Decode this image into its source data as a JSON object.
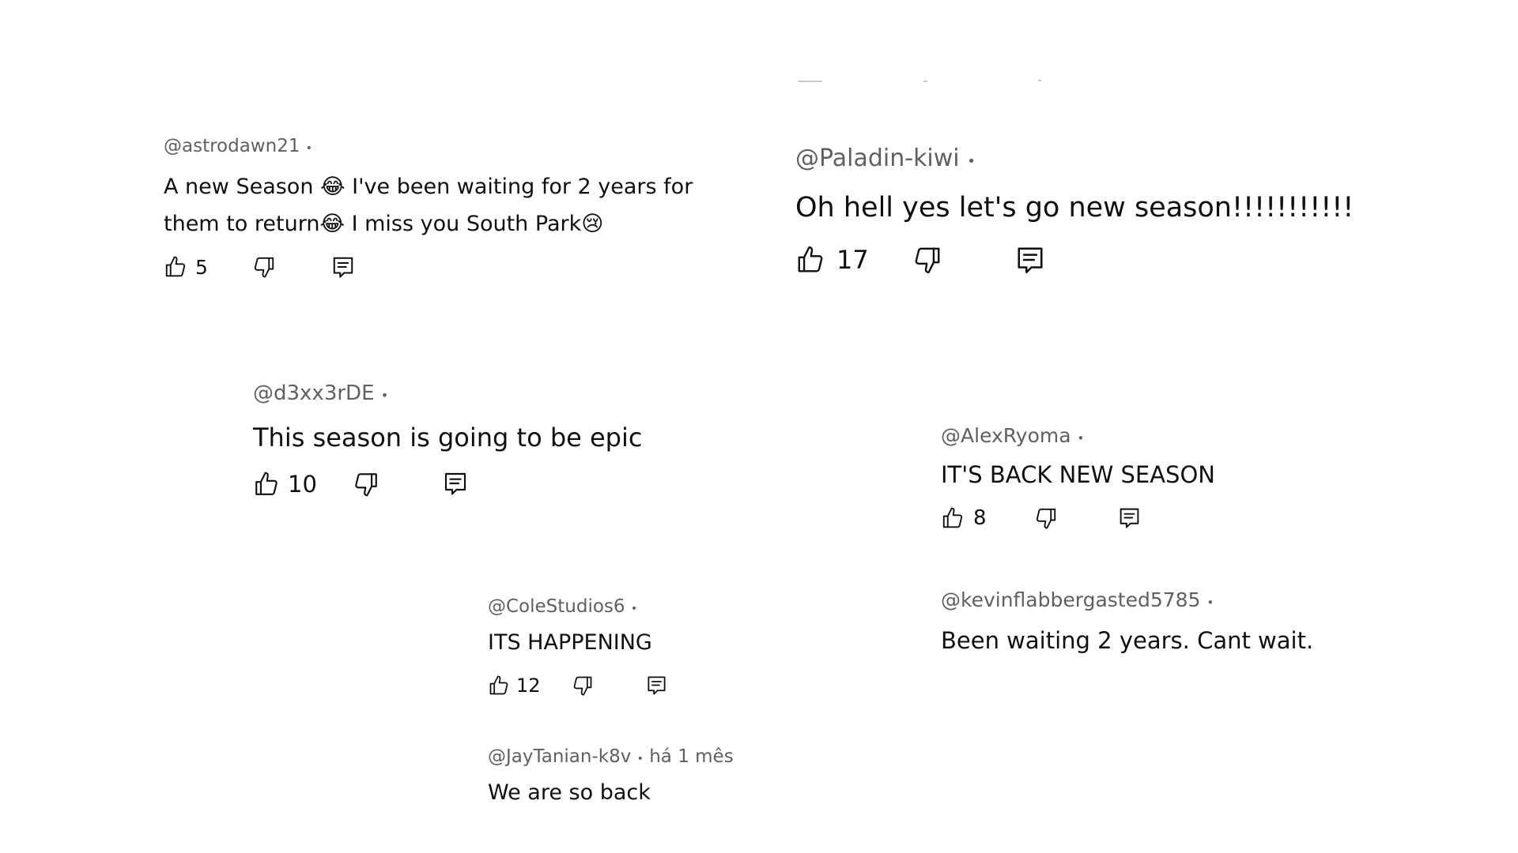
{
  "comments": [
    {
      "handle": "@astrodawn21",
      "separator": "•",
      "text": "A new Season 😂 I've been waiting for 2 years for them to return😂 I miss you South Park😢",
      "likes": "5"
    },
    {
      "handle": "@Paladin-kiwi",
      "separator": "•",
      "text": "Oh hell yes let's go new season!!!!!!!!!!!",
      "likes": "17"
    },
    {
      "handle": "@d3xx3rDE",
      "separator": "•",
      "text": "This season is going to be epic",
      "likes": "10"
    },
    {
      "handle": "@AlexRyoma",
      "separator": "•",
      "text": "IT'S BACK NEW SEASON",
      "likes": "8"
    },
    {
      "handle": "@ColeStudios6",
      "separator": "•",
      "text": "ITS HAPPENING",
      "likes": "12"
    },
    {
      "handle": "@kevinflabbergasted5785",
      "separator": "•",
      "text": "Been waiting 2 years. Cant wait."
    },
    {
      "handle": "@JayTanian-k8v",
      "separator": "•",
      "time": "há 1 mês",
      "text": "We are so back"
    }
  ],
  "icons": {
    "like": "thumbs-up-icon",
    "dislike": "thumbs-down-icon",
    "reply": "reply-icon"
  }
}
